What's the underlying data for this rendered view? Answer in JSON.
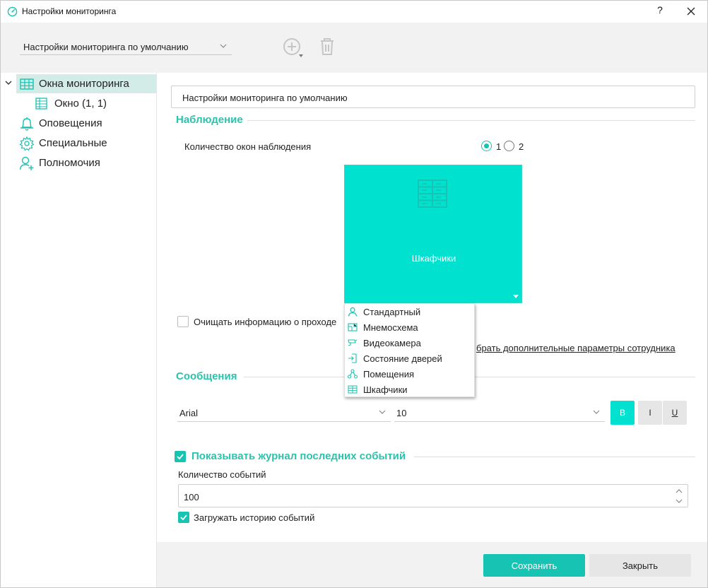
{
  "window": {
    "title": "Настройки мониторинга",
    "help_label": "?"
  },
  "toolbar": {
    "preset_value": "Настройки мониторинга по умолчанию"
  },
  "sidebar": {
    "items": [
      {
        "label": "Окна мониторинга",
        "icon": "grid-icon"
      },
      {
        "label": "Окно (1, 1)",
        "icon": "table-icon"
      },
      {
        "label": "Оповещения",
        "icon": "bell-icon"
      },
      {
        "label": "Специальные",
        "icon": "gear-icon"
      },
      {
        "label": "Полномочия",
        "icon": "user-plus-icon"
      }
    ]
  },
  "main": {
    "name_value": "Настройки мониторинга по умолчанию",
    "observation": {
      "heading": "Наблюдение",
      "window_count_label": "Количество окон наблюдения",
      "option_1": "1",
      "option_2": "2",
      "selected": "1"
    },
    "tile": {
      "label": "Шкафчики",
      "icon": "lockers-icon"
    },
    "clear_info_label": "Очищать информацию о проходе",
    "extra_params_link": "брать дополнительные параметры сотрудника",
    "messages": {
      "heading": "Сообщения",
      "font_value": "Arial",
      "size_value": "10",
      "bold_label": "B",
      "italic_label": "I",
      "underline_label": "U"
    },
    "journal": {
      "heading": "Показывать журнал последних событий",
      "checked": true,
      "count_label": "Количество событий",
      "count_value": "100",
      "load_history_label": "Загружать историю событий",
      "load_history_checked": true
    }
  },
  "dropdown_menu": {
    "items": [
      {
        "label": "Стандартный",
        "icon": "person-icon"
      },
      {
        "label": "Мнемосхема",
        "icon": "mnemo-icon"
      },
      {
        "label": "Видеокамера",
        "icon": "camera-icon"
      },
      {
        "label": "Состояние дверей",
        "icon": "door-icon"
      },
      {
        "label": "Помещения",
        "icon": "network-icon"
      },
      {
        "label": "Шкафчики",
        "icon": "lockers-icon"
      }
    ]
  },
  "footer": {
    "save_label": "Сохранить",
    "close_label": "Закрыть"
  },
  "colors": {
    "accent": "#17c3b2",
    "tile": "#00e2cf",
    "selected_bg": "#d3ece8"
  }
}
